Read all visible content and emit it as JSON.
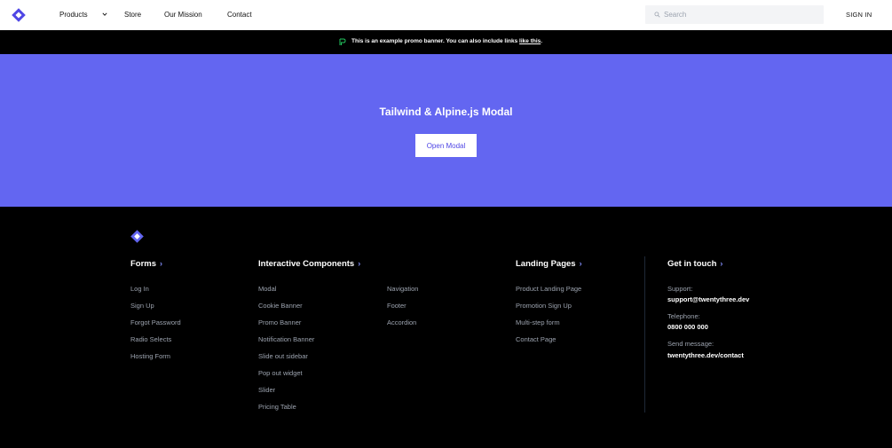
{
  "header": {
    "nav": [
      "Products",
      "Store",
      "Our Mission",
      "Contact"
    ],
    "search_placeholder": "Search",
    "signin": "SIGN IN"
  },
  "promo": {
    "text": "This is an example promo banner. You can also include links",
    "link": "like this",
    "end": "."
  },
  "hero": {
    "title": "Tailwind & Alpine.js Modal",
    "button": "Open Modal"
  },
  "footer": {
    "columns": [
      {
        "heading": "Forms",
        "links": [
          "Log In",
          "Sign Up",
          "Forgot Password",
          "Radio Selects",
          "Hosting Form"
        ]
      },
      {
        "heading": "Interactive Components",
        "links": [
          "Modal",
          "Cookie Banner",
          "Promo Banner",
          "Notification Banner",
          "Slide out sidebar",
          "Pop out widget",
          "Slider",
          "Pricing Table"
        ],
        "links2": [
          "Navigation",
          "Footer",
          "Accordion"
        ]
      },
      {
        "heading": "Landing Pages",
        "links": [
          "Product Landing Page",
          "Promotion Sign Up",
          "Multi-step form",
          "Contact Page"
        ]
      }
    ],
    "contact": {
      "heading": "Get in touch",
      "support_label": "Support:",
      "support_value": "support@twentythree.dev",
      "phone_label": "Telephone:",
      "phone_value": "0800 000 000",
      "message_label": "Send message:",
      "message_value": "twentythree.dev/contact"
    }
  },
  "colors": {
    "accent": "#6366f1",
    "accent_dark": "#4f46e5",
    "footer_bg": "#000000",
    "link_gray": "#9ca3af",
    "promo_icon": "#22c55e"
  },
  "icons": {
    "logo": "diamond-logo-icon",
    "products_chevron": "chevron-down-icon",
    "search": "search-icon",
    "promo": "tag-icon",
    "heading_arrow": "chevron-right-icon"
  }
}
